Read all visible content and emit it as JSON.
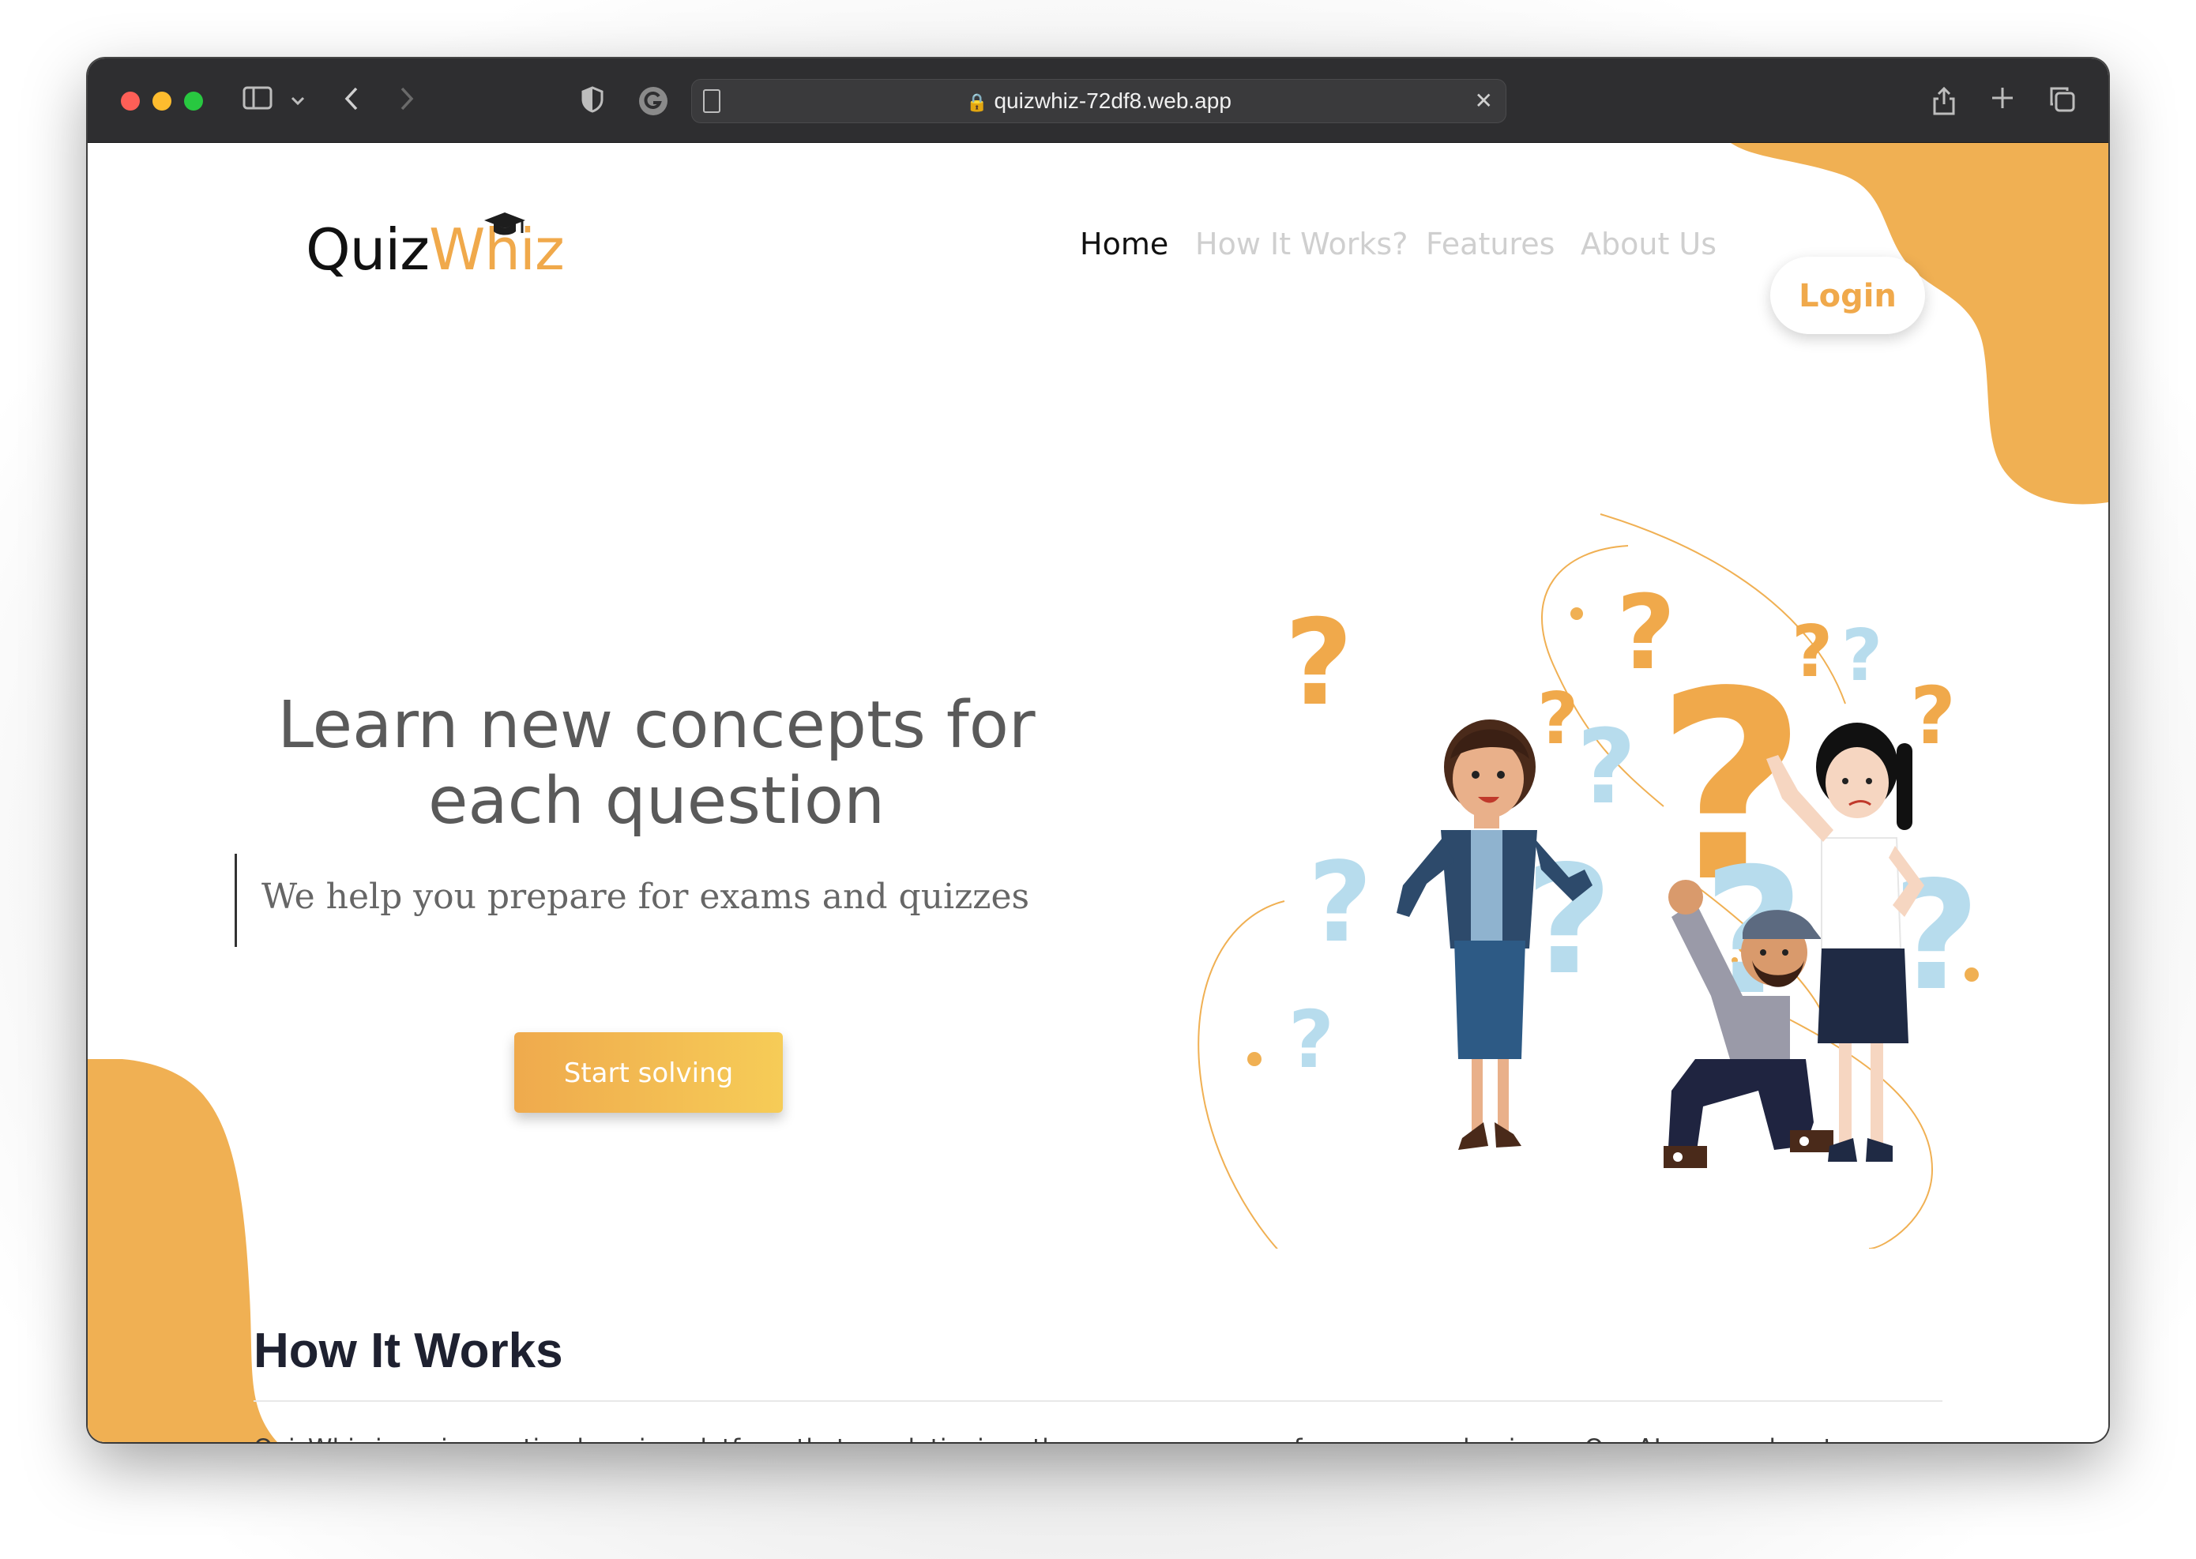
{
  "browser": {
    "url": "quizwhiz-72df8.web.app",
    "icons": [
      "sidebar-icon",
      "chevron-down-icon",
      "back-icon",
      "forward-icon",
      "shield-icon",
      "grammarly-icon",
      "reader-icon",
      "lock-icon",
      "close-icon",
      "share-icon",
      "new-tab-icon",
      "tabs-overview-icon"
    ]
  },
  "header": {
    "logo_left": "Quiz",
    "logo_right": "Whiz",
    "nav": {
      "home": "Home",
      "how": "How It Works?",
      "features": "Features",
      "about": "About Us"
    },
    "login_label": "Login"
  },
  "hero": {
    "title_line1": "Learn new concepts for",
    "title_line2": "each question",
    "subtitle": "We help you prepare for exams and quizzes",
    "cta_label": "Start solving"
  },
  "how_it_works": {
    "title": "How It Works",
    "paragraph": "QuizWhiz is an innovative learning platform that revolutionizes the way you prepare for exams and quizzes. Our AI-powered system generates personalized quizzes based on different difficulty levels and subjects, aligning with your institution's curriculum. You'll be"
  },
  "colors": {
    "accent": "#f0a94b",
    "accent_light": "#f6cc57",
    "nav_inactive": "#cfcfcf",
    "question_blue": "#b7dced"
  }
}
